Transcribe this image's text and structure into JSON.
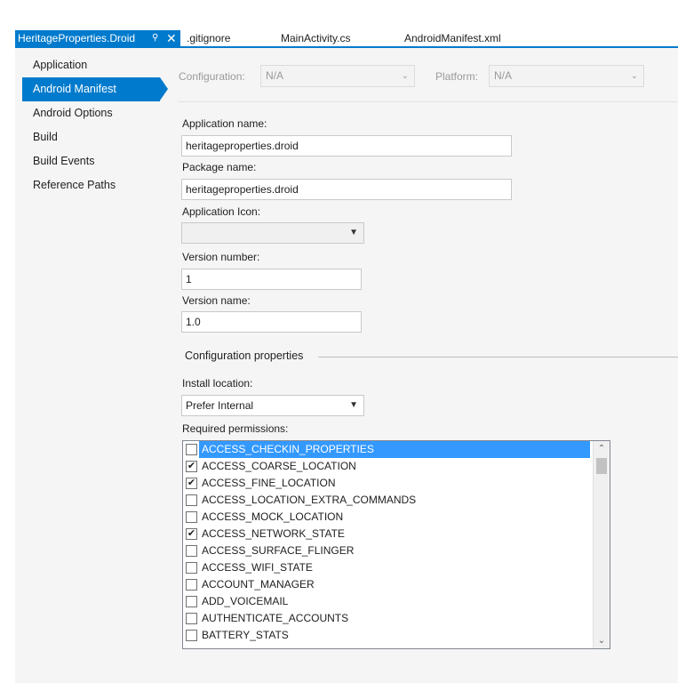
{
  "tabs": [
    {
      "label": "HeritageProperties.Droid",
      "active": true
    },
    {
      "label": ".gitignore"
    },
    {
      "label": "MainActivity.cs"
    },
    {
      "label": "AndroidManifest.xml"
    }
  ],
  "tab_icons": {
    "pin": "pin-icon",
    "close": "close-icon"
  },
  "sidebar": {
    "items": [
      {
        "label": "Application"
      },
      {
        "label": "Android Manifest",
        "selected": true
      },
      {
        "label": "Android Options"
      },
      {
        "label": "Build"
      },
      {
        "label": "Build Events"
      },
      {
        "label": "Reference Paths"
      }
    ]
  },
  "config": {
    "configuration_label": "Configuration:",
    "configuration_value": "N/A",
    "platform_label": "Platform:",
    "platform_value": "N/A"
  },
  "form": {
    "app_name_label": "Application name:",
    "app_name_value": "heritageproperties.droid",
    "package_name_label": "Package name:",
    "package_name_value": "heritageproperties.droid",
    "app_icon_label": "Application Icon:",
    "app_icon_value": "",
    "version_number_label": "Version number:",
    "version_number_value": "1",
    "version_name_label": "Version name:",
    "version_name_value": "1.0",
    "config_props_title": "Configuration properties",
    "install_location_label": "Install location:",
    "install_location_value": "Prefer Internal",
    "required_permissions_label": "Required permissions:"
  },
  "permissions": [
    {
      "name": "ACCESS_CHECKIN_PROPERTIES",
      "checked": false,
      "highlighted": true
    },
    {
      "name": "ACCESS_COARSE_LOCATION",
      "checked": true
    },
    {
      "name": "ACCESS_FINE_LOCATION",
      "checked": true
    },
    {
      "name": "ACCESS_LOCATION_EXTRA_COMMANDS",
      "checked": false
    },
    {
      "name": "ACCESS_MOCK_LOCATION",
      "checked": false
    },
    {
      "name": "ACCESS_NETWORK_STATE",
      "checked": true
    },
    {
      "name": "ACCESS_SURFACE_FLINGER",
      "checked": false
    },
    {
      "name": "ACCESS_WIFI_STATE",
      "checked": false
    },
    {
      "name": "ACCOUNT_MANAGER",
      "checked": false
    },
    {
      "name": "ADD_VOICEMAIL",
      "checked": false
    },
    {
      "name": "AUTHENTICATE_ACCOUNTS",
      "checked": false
    },
    {
      "name": "BATTERY_STATS",
      "checked": false
    }
  ],
  "colors": {
    "accent": "#007acc",
    "selection": "#3399ff",
    "panel_bg": "#f5f5f5"
  }
}
